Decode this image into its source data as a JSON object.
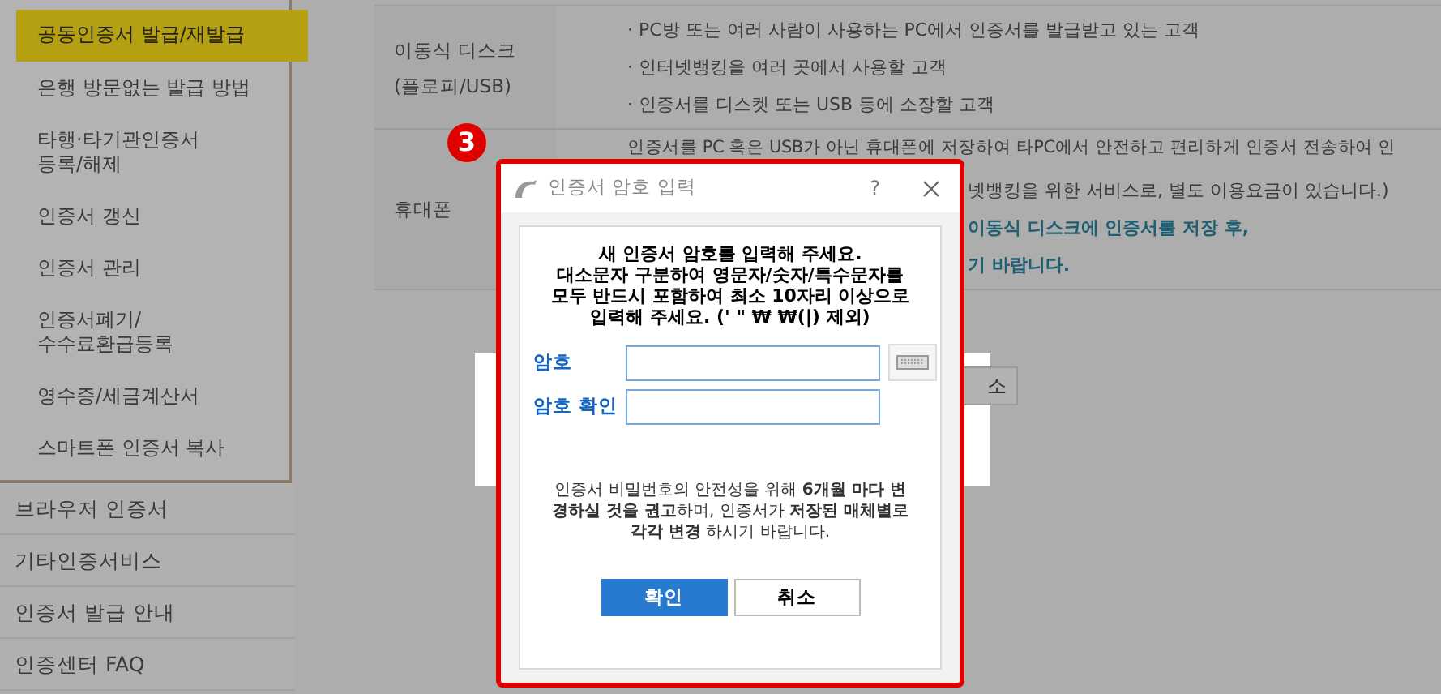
{
  "sidebar": {
    "submenu": [
      {
        "label": "공동인증서 발급/재발급",
        "selected": true
      },
      {
        "label": "은행 방문없는 발급 방법",
        "selected": false
      },
      {
        "label": "타행·타기관인증서\n등록/해제",
        "selected": false
      },
      {
        "label": "인증서 갱신",
        "selected": false
      },
      {
        "label": "인증서 관리",
        "selected": false
      },
      {
        "label": "인증서폐기/\n수수료환급등록",
        "selected": false
      },
      {
        "label": "영수증/세금계산서",
        "selected": false
      },
      {
        "label": "스마트폰 인증서 복사",
        "selected": false
      }
    ],
    "items": [
      "브라우저 인증서",
      "기타인증서비스",
      "인증서 발급 안내",
      "인증센터 FAQ"
    ]
  },
  "table": {
    "rows": [
      {
        "label": "이동식 디스크\n(플로피/USB)",
        "lines": [
          {
            "kind": "bullet",
            "bullet": "·",
            "text": "PC방 또는 여러 사람이 사용하는 PC에서 인증서를 발급받고 있는 고객"
          },
          {
            "kind": "bullet",
            "bullet": "·",
            "text": "인터넷뱅킹을 여러 곳에서 사용할 고객"
          },
          {
            "kind": "bullet",
            "bullet": "·",
            "text": "인증서를 디스켓 또는 USB 등에 소장할 고객"
          }
        ]
      },
      {
        "label": "휴대폰",
        "lines": [
          {
            "kind": "plain",
            "text": "인증서를 PC 혹은 USB가 아닌 휴대폰에 저장하여 타PC에서 안전하고 편리하게 인증서 전송하여 인"
          },
          {
            "kind": "clipped",
            "text": "넷뱅킹을 위한 서비스로, 별도 이용요금이 있습니다.)"
          },
          {
            "kind": "clipped-note",
            "text": "이동식 디스크에 인증서를 저장 후,"
          },
          {
            "kind": "clipped-note",
            "text": "기 바랍니다."
          }
        ]
      }
    ]
  },
  "behind_button": "소",
  "step_badge": "3",
  "dialog": {
    "title": "인증서 암호 입력",
    "help": "?",
    "instructions": [
      "새 인증서 암호를 입력해 주세요.",
      "대소문자 구분하여 영문자/숫자/특수문자를",
      "모두 반드시 포함하여 최소 10자리 이상으로",
      "입력해 주세요. (' \" ₩ ₩(|) 제외)"
    ],
    "fields": [
      {
        "label": "암호",
        "kind": "with-keyboard"
      },
      {
        "label": "암호 확인",
        "kind": "plain"
      }
    ],
    "note": "인증서 비밀번호의 안전성을 위해 **6개월 마다 변경하실 것을 권고**하며, 인증서가 **저장된 매체별로 각각 변경** 하시기 바랍니다.",
    "buttons": [
      {
        "label": "확인",
        "kind": "primary"
      },
      {
        "label": "취소",
        "kind": "secondary"
      }
    ]
  }
}
